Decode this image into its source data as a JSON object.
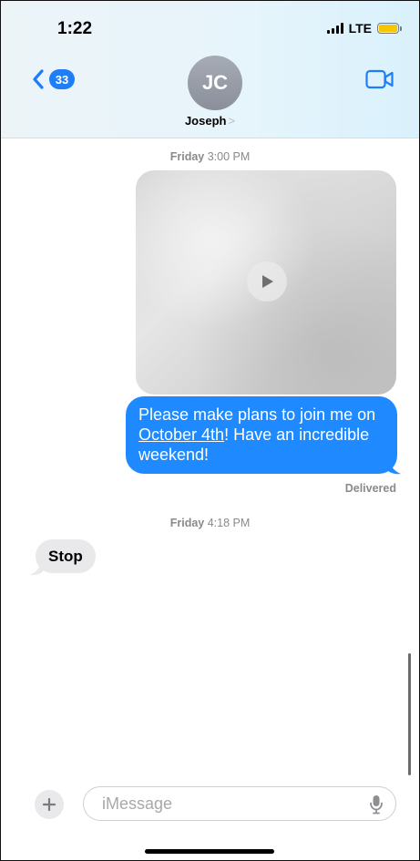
{
  "status_bar": {
    "time": "1:22",
    "network": "LTE",
    "battery_color": "#f7c600"
  },
  "header": {
    "back_badge": "33",
    "avatar_initials": "JC",
    "contact_name": "Joseph",
    "contact_chevron": ">",
    "accent": "#1f7ef5"
  },
  "messages": {
    "timestamp_1_day": "Friday",
    "timestamp_1_time": "3:00 PM",
    "outgoing_text_before": "Please make plans to join me on ",
    "outgoing_link": "October 4th",
    "outgoing_text_after": "! Have an incredible weekend!",
    "delivered_label": "Delivered",
    "timestamp_2_day": "Friday",
    "timestamp_2_time": "4:18 PM",
    "incoming_text": "Stop",
    "outgoing_color": "#1f8aff",
    "incoming_color": "#e9e9eb"
  },
  "compose": {
    "placeholder": "iMessage",
    "value": ""
  }
}
